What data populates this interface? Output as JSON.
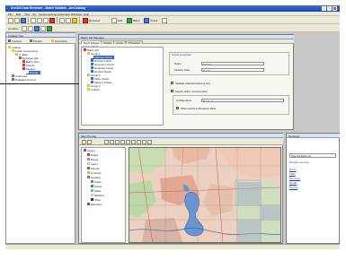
{
  "window": {
    "title": "ArcGIS Data Reviewer - Batch Validate - ArcCatalog",
    "controls": [
      "minimize",
      "maximize",
      "close"
    ]
  },
  "menubar": [
    "File",
    "Edit",
    "View",
    "Go",
    "Geoprocessing",
    "Customize",
    "Windows",
    "Help"
  ],
  "toolbar": {
    "location_label": "Location:",
    "labels": [
      "Reviewer",
      "Edit",
      "Batch",
      "Check"
    ]
  },
  "left_panel": {
    "title": "Catalog Tree",
    "tabs": [
      "Contents",
      "Preview",
      "Description"
    ],
    "tree": [
      "Catalog",
      "Folder Connections",
      "C:\\Data",
      "Reviewer.gdb",
      "Batch Jobs",
      "Checks",
      "Session",
      "Results",
      "Toolboxes",
      "Database Servers"
    ]
  },
  "top_frame": {
    "title": "Batch Job Manager",
    "tabs": [
      "Batch Validate",
      "Checks",
      "Layers",
      "Properties"
    ],
    "subtabs": [
      "Group",
      "Check"
    ],
    "tree_root": "Batch Job",
    "tree": [
      "Group 1",
      "Attribute Check",
      "Domain Check",
      "Geometry Check",
      "Duplicate Check",
      "Orphan Check",
      "Group 2",
      "Table Check",
      "Valency Check",
      "Group 3",
      "Custom"
    ],
    "properties": {
      "section": "Check properties",
      "name_label": "Name",
      "name_value": "Attribute",
      "feature_label": "Feature class",
      "feature_value": "Roads",
      "opt1": "Validate selected features only",
      "opt2": "Search within current extent",
      "config_label": "Configuration",
      "config_value": "Batch job",
      "opt3": "Write results to Reviewer table"
    }
  },
  "bottom_frame": {
    "title": "Map Preview",
    "legend": [
      "Layers",
      "Roads",
      "Rivers",
      "Lakes",
      "Parcels",
      "Contours",
      "Landuse",
      "Urban",
      "Forest",
      "Water",
      "Wetland",
      "Other",
      "Boundary"
    ],
    "legend_colors": [
      "#3a6fbf",
      "#d13b2b",
      "#6aa1d8",
      "#e1b7a3",
      "#8c6a3c",
      "#a3c77f",
      "#c65c50",
      "#5e9a4a",
      "#4d77c0",
      "#7fb8a0",
      "#c9c9c9",
      "#333333"
    ]
  },
  "right_pane": {
    "title": "Reviewer",
    "dropdown": "Select a batch job",
    "section": "Results summary",
    "links": [
      "Errors",
      "Table",
      "Summary",
      "Details",
      "Browse"
    ]
  },
  "colors": {
    "titlebar": "#1c48b0",
    "chrome": "#ece9d8",
    "map_land": "#e9c2b0",
    "map_water": "#6a95d3",
    "map_green": "#b8d6a0"
  }
}
